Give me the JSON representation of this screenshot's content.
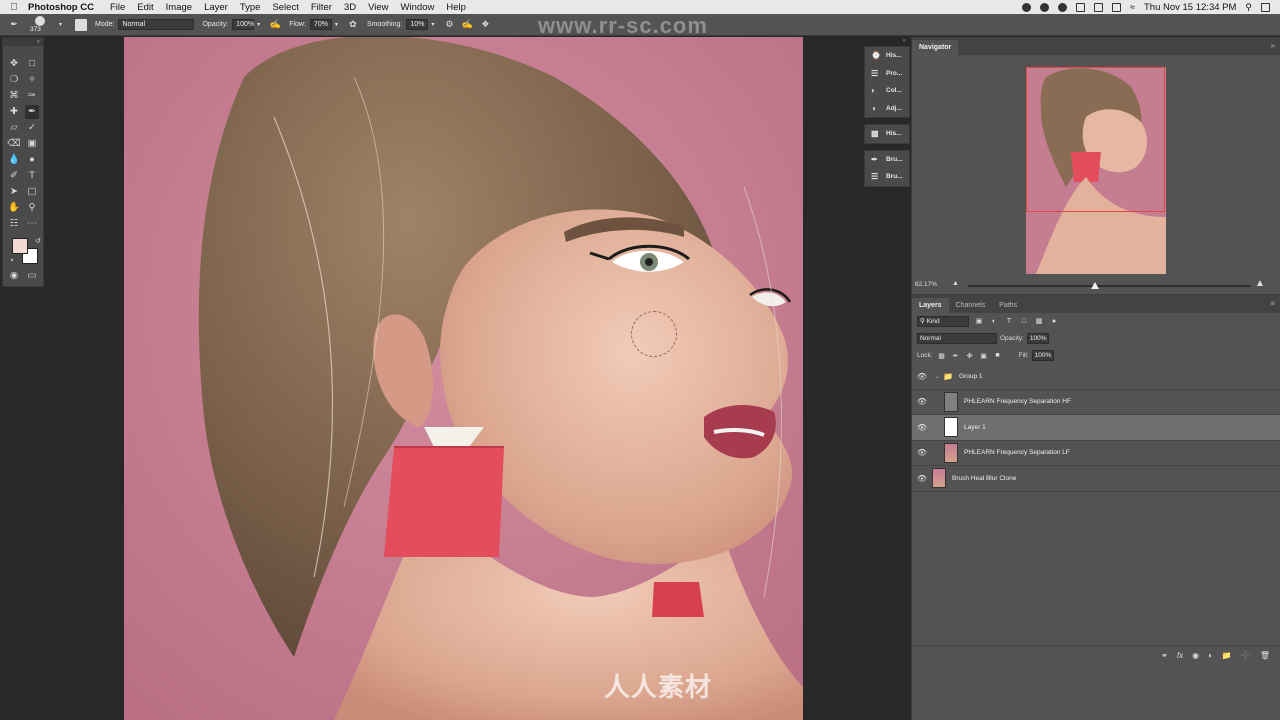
{
  "menubar": {
    "app_name": "Photoshop CC",
    "menus": [
      "File",
      "Edit",
      "Image",
      "Layer",
      "Type",
      "Select",
      "Filter",
      "3D",
      "View",
      "Window",
      "Help"
    ],
    "clock": "Thu Nov 15  12:34 PM"
  },
  "watermark": {
    "url": "www.rr-sc.com",
    "brand": "人人素材"
  },
  "options_bar": {
    "brush_size": "373",
    "mode_label": "Mode:",
    "mode_value": "Normal",
    "opacity_label": "Opacity:",
    "opacity_value": "100%",
    "flow_label": "Flow:",
    "flow_value": "70%",
    "smoothing_label": "Smoothing:",
    "smoothing_value": "10%"
  },
  "toolbar": {
    "foreground_color": "#f2d9d4",
    "background_color": "#ffffff"
  },
  "dock": {
    "group1": [
      {
        "icon": "history-icon",
        "label": "His..."
      },
      {
        "icon": "properties-icon",
        "label": "Pro..."
      },
      {
        "icon": "color-icon",
        "label": "Col..."
      },
      {
        "icon": "adjustments-icon",
        "label": "Adj..."
      }
    ],
    "group2": [
      {
        "icon": "histogram-icon",
        "label": "His..."
      }
    ],
    "group3": [
      {
        "icon": "brush-icon",
        "label": "Bru..."
      },
      {
        "icon": "brush-settings-icon",
        "label": "Bru..."
      }
    ]
  },
  "navigator": {
    "tab": "Navigator",
    "zoom": "62.17%",
    "zoom_fraction": 0.45
  },
  "layers_panel": {
    "tabs": [
      "Layers",
      "Channels",
      "Paths"
    ],
    "filter_kind": "Kind",
    "blend_mode": "Normal",
    "opacity_label": "Opacity:",
    "opacity_value": "100%",
    "lock_label": "Lock:",
    "fill_label": "Fill:",
    "fill_value": "100%",
    "layers": [
      {
        "name": "Group 1",
        "type": "group"
      },
      {
        "name": "PHLEARN Frequency Separation HF",
        "type": "gray"
      },
      {
        "name": "Layer 1",
        "type": "white",
        "selected": true
      },
      {
        "name": "PHLEARN Frequency Separation LF",
        "type": "photo"
      },
      {
        "name": "Brush Heal Blur Clone",
        "type": "photo"
      }
    ]
  }
}
